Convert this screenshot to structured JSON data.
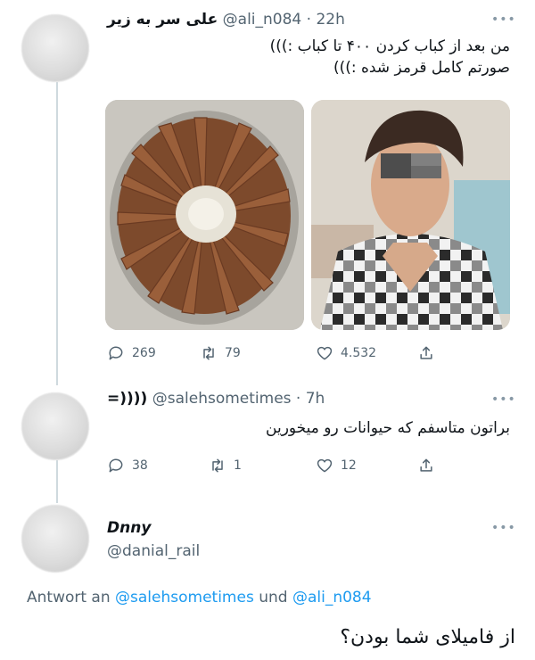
{
  "tweet1": {
    "display_name": "علی سر به زیر",
    "handle": "@ali_n084",
    "time": "· 22h",
    "text_line1": "من بعد از کباب کردن ۴۰۰ تا کباب :)))",
    "text_line2": "صورتم کامل قرمز شده :)))",
    "replies": "269",
    "retweets": "79",
    "likes": "4.532"
  },
  "tweet2": {
    "display_name": "=))))",
    "handle": "@salehsometimes",
    "time": "· 7h",
    "text": "براتون متاسفم که حیوانات رو میخورین",
    "replies": "38",
    "retweets": "1",
    "likes": "12"
  },
  "tweet3": {
    "display_name": "Dnny",
    "handle": "@danial_rail",
    "reply_prefix": "Antwort an",
    "reply_to1": "@salehsometimes",
    "reply_joiner": "und",
    "reply_to2": "@ali_n084",
    "text": "از فامیلای شما بودن؟"
  },
  "icons": {
    "more": "more-dots-icon",
    "reply": "reply-icon",
    "retweet": "retweet-icon",
    "like": "heart-icon",
    "share": "share-icon"
  },
  "colors": {
    "link": "#1d9bf0",
    "muted": "#536471",
    "line": "#cfd9de"
  }
}
